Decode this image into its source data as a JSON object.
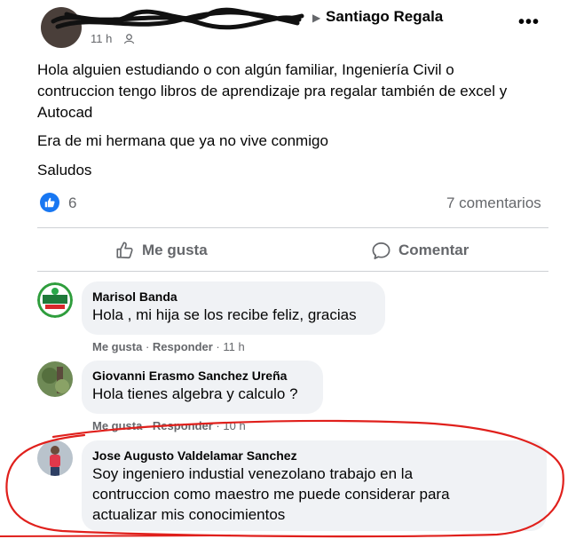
{
  "header": {
    "group_name": "Santiago Regala",
    "time": "11 h",
    "more_label": "•••"
  },
  "post": {
    "lines": [
      "Hola alguien estudiando o con algún familiar, Ingeniería Civil o",
      "contruccion tengo libros de aprendizaje pra regalar también de excel y",
      "Autocad",
      "Era de mi hermana que ya no vive conmigo",
      "Saludos"
    ]
  },
  "stats": {
    "likes": "6",
    "comments": "7 comentarios"
  },
  "actions": {
    "like": "Me gusta",
    "comment": "Comentar"
  },
  "comments": [
    {
      "name": "Marisol Banda",
      "lines": [
        "Hola , mi hija se los recibe feliz, gracias"
      ],
      "like": "Me gusta",
      "reply": "Responder",
      "time": "11 h"
    },
    {
      "name": "Giovanni Erasmo Sanchez Ureña",
      "lines": [
        "Hola tienes algebra y calculo ?"
      ],
      "like": "Me gusta",
      "reply": "Responder",
      "time": "10 h"
    },
    {
      "name": "Jose Augusto Valdelamar Sanchez",
      "lines": [
        "Soy ingeniero industial venezolano trabajo en la",
        "contruccion como maestro me puede considerar para",
        "actualizar mis conocimientos"
      ]
    }
  ],
  "colors": {
    "accent": "#1877f2",
    "muted": "#65676b",
    "bubble": "#f0f2f5",
    "annotation": "#e0201c"
  }
}
